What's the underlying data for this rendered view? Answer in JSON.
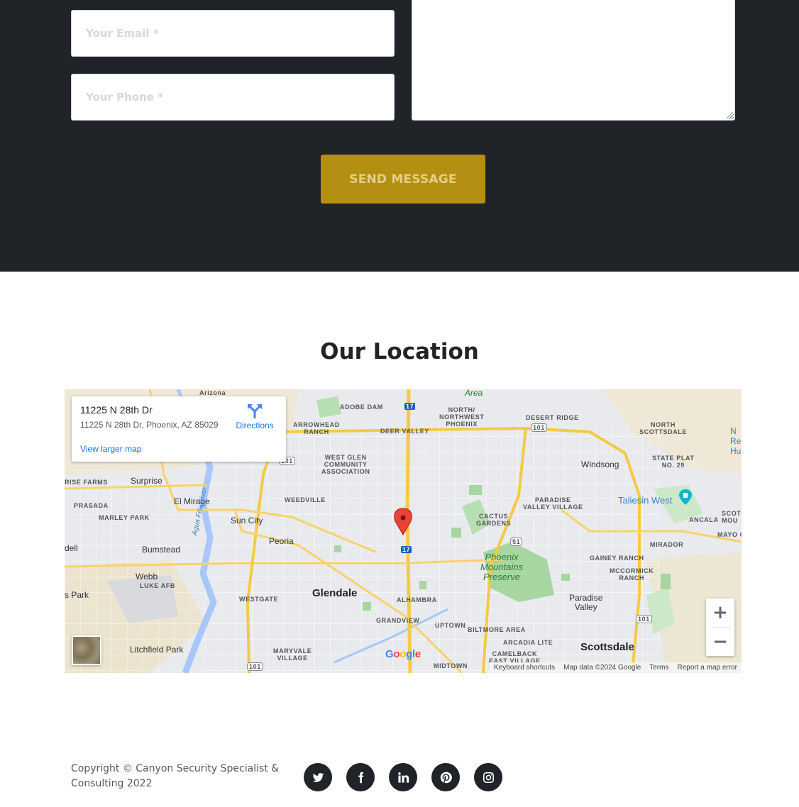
{
  "contact_form": {
    "email_placeholder": "Your Email *",
    "email_value": "",
    "phone_placeholder": "Your Phone *",
    "phone_value": "",
    "message_value": "",
    "send_label": "SEND MESSAGE",
    "colors": {
      "section_bg": "#202328",
      "button_bg": "#b39011",
      "button_text": "#e1cf8a"
    }
  },
  "location": {
    "title": "Our Location"
  },
  "map": {
    "info_title": "11225 N 28th Dr",
    "info_address": "11225 N 28th Dr, Phoenix, AZ 85029",
    "directions_label": "Directions",
    "larger_map_label": "View larger map",
    "zoom_in_label": "+",
    "zoom_out_label": "−",
    "attribution": {
      "shortcuts": "Keyboard shortcuts",
      "data": "Map data ©2024 Google",
      "terms": "Terms",
      "report": "Report a map error"
    },
    "places": {
      "area": "Area",
      "arizona": "Arizona",
      "adobe_dam": "ADOBE DAM",
      "north_nw_phoenix": "NORTH/\nNORTHWEST\nPHOENIX",
      "desert_ridge": "DESERT RIDGE",
      "north_scottsdale": "NORTH\nSCOTTSDALE",
      "arrowhead_ranch": "ARROWHEAD\nRANCH",
      "deer_valley": "DEER VALLEY",
      "west_glen": "WEST GLEN\nCOMMUNITY\nASSOCIATION",
      "windsong": "Windsong",
      "state_plat": "STATE PLAT\nNO. 29",
      "rise_farms": "RISE FARMS",
      "surprise": "Surprise",
      "prasada": "PRASADA",
      "el_mirage": "El Mirage",
      "weedville": "WEEDVILLE",
      "paradise_valley_village": "PARADISE\nVALLEY VILLAGE",
      "taliesin_west": "Taliesin West",
      "marley_park": "MARLEY PARK",
      "sun_city": "Sun City",
      "cactus_gardens": "CACTUS\nGARDENS",
      "ancala": "ANCALA",
      "agua_fria": "Agua Fria River",
      "bumstead": "Bumstead",
      "peoria": "Peoria",
      "phoenix_mountains": "Phoenix\nMountains\nPreserve",
      "mirador": "MIRADOR",
      "dell": "dell",
      "webb_luke": "Webb",
      "luke_afb": "LUKE AFB",
      "gainey_ranch": "GAINEY RANCH",
      "mccormick_ranch": "MCCORMICK\nRANCH",
      "s_park": "s Park",
      "westgate": "WESTGATE",
      "glendale": "Glendale",
      "alhambra": "ALHAMBRA",
      "paradise_valley": "Paradise\nValley",
      "grandview": "GRANDVIEW",
      "uptown": "UPTOWN",
      "biltmore": "BILTMORE AREA",
      "litchfield_park": "Litchfield Park",
      "maryvale": "MARYVALE\nVILLAGE",
      "arcadia_lite": "ARCADIA LITE",
      "camelback": "CAMELBACK\nEAST VILLAGE",
      "scottsdale": "Scottsdale",
      "midtown": "MIDTOWN",
      "mayo": "MAYO C",
      "scot_mou": "SCOT\nMOU",
      "re_hu": "N\nRe\nHu",
      "hwy_17a": "17",
      "hwy_17b": "17",
      "hwy_101a": "101",
      "hwy_101b": "101",
      "hwy_101c": "101",
      "hwy_101d": "101",
      "hwy_51": "51"
    }
  },
  "footer": {
    "copyright": "Copyright © Canyon Security Specialist & Consulting 2022",
    "social": [
      {
        "name": "twitter-icon"
      },
      {
        "name": "facebook-icon"
      },
      {
        "name": "linkedin-icon"
      },
      {
        "name": "pinterest-icon"
      },
      {
        "name": "instagram-icon"
      }
    ]
  }
}
